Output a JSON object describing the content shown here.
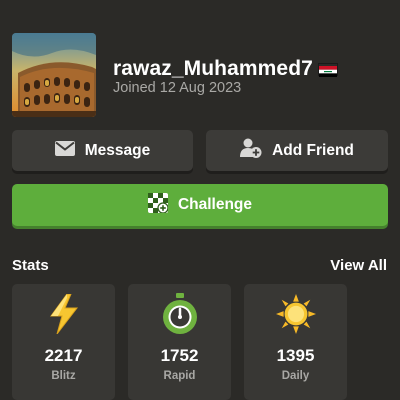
{
  "profile": {
    "username": "rawaz_Muhammed7",
    "flag_icon": "iraq-flag-icon",
    "joined": "Joined 12 Aug 2023",
    "avatar_icon": "colosseum-avatar"
  },
  "actions": {
    "message_label": "Message",
    "message_icon": "envelope-icon",
    "add_friend_label": "Add Friend",
    "add_friend_icon": "add-person-icon",
    "challenge_label": "Challenge",
    "challenge_icon": "chessboard-icon"
  },
  "stats": {
    "title": "Stats",
    "view_all": "View All",
    "items": [
      {
        "value": "2217",
        "label": "Blitz",
        "icon": "lightning-icon"
      },
      {
        "value": "1752",
        "label": "Rapid",
        "icon": "stopwatch-icon"
      },
      {
        "value": "1395",
        "label": "Daily",
        "icon": "sun-icon"
      }
    ]
  },
  "colors": {
    "background": "#2b2a27",
    "button_dark": "#3c3b38",
    "challenge_green": "#5eae3c",
    "card": "#383734",
    "muted_text": "#a9a8a5"
  }
}
